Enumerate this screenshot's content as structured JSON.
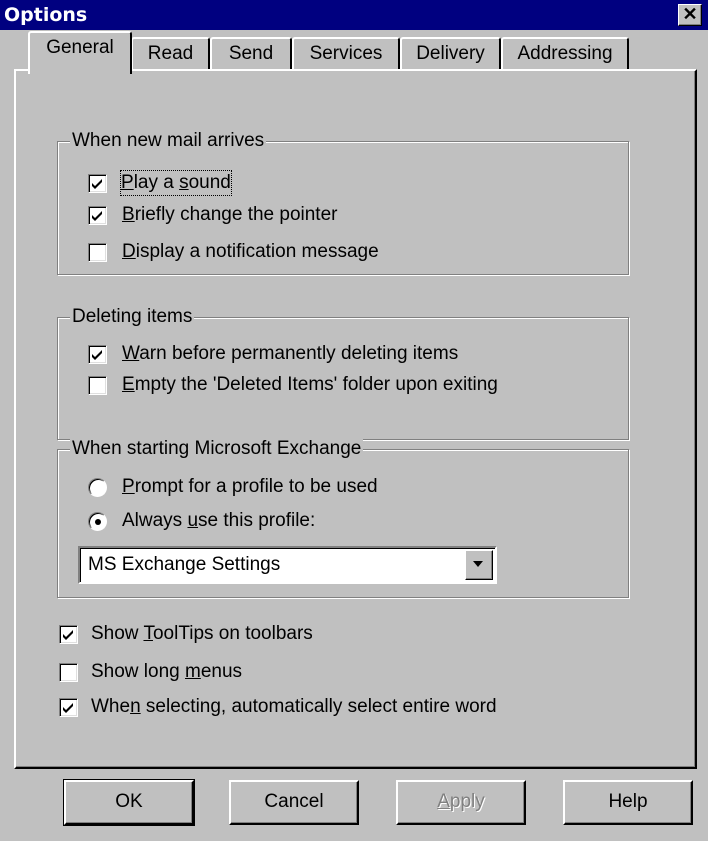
{
  "window": {
    "title": "Options",
    "close_glyph": "✕"
  },
  "tabs": [
    {
      "label": "General",
      "active": true
    },
    {
      "label": "Read",
      "active": false
    },
    {
      "label": "Send",
      "active": false
    },
    {
      "label": "Services",
      "active": false
    },
    {
      "label": "Delivery",
      "active": false
    },
    {
      "label": "Addressing",
      "active": false
    }
  ],
  "new_mail": {
    "legend": "When new mail arrives",
    "options": [
      {
        "pre": "",
        "key": "P",
        "post": "lay a ",
        "key2": "s",
        "post2": "ound",
        "checked": true
      },
      {
        "pre": "",
        "key": "B",
        "post": "riefly change the pointer",
        "checked": true
      },
      {
        "pre": "",
        "key": "D",
        "post": "isplay a notification message",
        "checked": false
      }
    ]
  },
  "deleting": {
    "legend": "Deleting items",
    "options": [
      {
        "pre": "",
        "key": "W",
        "post": "arn before permanently deleting items",
        "checked": true
      },
      {
        "pre": "",
        "key": "E",
        "post": "mpty the 'Deleted Items' folder upon exiting",
        "checked": false
      }
    ]
  },
  "starting": {
    "legend": "When starting Microsoft Exchange",
    "radios": [
      {
        "pre": "",
        "key": "P",
        "post": "rompt for a profile to be used",
        "selected": false
      },
      {
        "pre": "Always ",
        "key": "u",
        "post": "se this profile:",
        "selected": true
      }
    ],
    "profile_value": "MS Exchange Settings"
  },
  "general_options": [
    {
      "pre": "Show ",
      "key": "T",
      "post": "oolTips on toolbars",
      "checked": true
    },
    {
      "pre": "Show long ",
      "key": "m",
      "post": "enus",
      "checked": false
    },
    {
      "pre": "Whe",
      "key": "n",
      "post": " selecting, automatically select entire word",
      "checked": true
    }
  ],
  "buttons": {
    "ok": "OK",
    "cancel": "Cancel",
    "apply_key": "A",
    "apply_rest": "pply",
    "help": "Help"
  },
  "colors": {
    "face": "#c0c0c0",
    "titlebar": "#000080",
    "shadow": "#808080",
    "highlight": "#ffffff"
  }
}
